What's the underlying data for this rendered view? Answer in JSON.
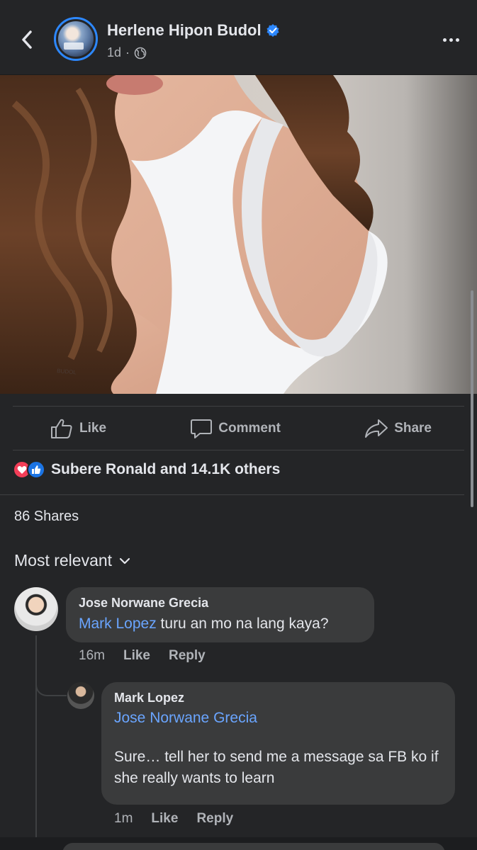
{
  "header": {
    "back_icon": "chevron-left-icon",
    "page_name": "Herlene Hipon Budol",
    "verified_icon": "verified-badge-icon",
    "time_ago": "1d",
    "separator": "·",
    "audience_icon": "globe-icon",
    "more_icon": "more-horizontal-icon"
  },
  "actions": {
    "like": "Like",
    "comment": "Comment",
    "share": "Share"
  },
  "reactions": {
    "icons": [
      "love-reaction-icon",
      "like-reaction-icon"
    ],
    "summary": "Subere Ronald and 14.1K others"
  },
  "shares": "86 Shares",
  "sort": {
    "label": "Most relevant",
    "icon": "chevron-down-icon"
  },
  "comments": [
    {
      "author": "Jose Norwane Grecia",
      "mention": "Mark Lopez",
      "text": " turu an mo na lang kaya?",
      "time": "16m",
      "like": "Like",
      "reply": "Reply"
    },
    {
      "author": "Mark Lopez",
      "mention": "Jose Norwane Grecia",
      "text": "Sure… tell her to send me a message sa FB ko if she really wants to learn",
      "time": "1m",
      "like": "Like",
      "reply": "Reply"
    }
  ],
  "colors": {
    "background": "#242527",
    "bubble": "#3a3b3c",
    "accent": "#2d88ff",
    "mention": "#6aa5ff",
    "love": "#f33e58",
    "like": "#1b74e4"
  }
}
